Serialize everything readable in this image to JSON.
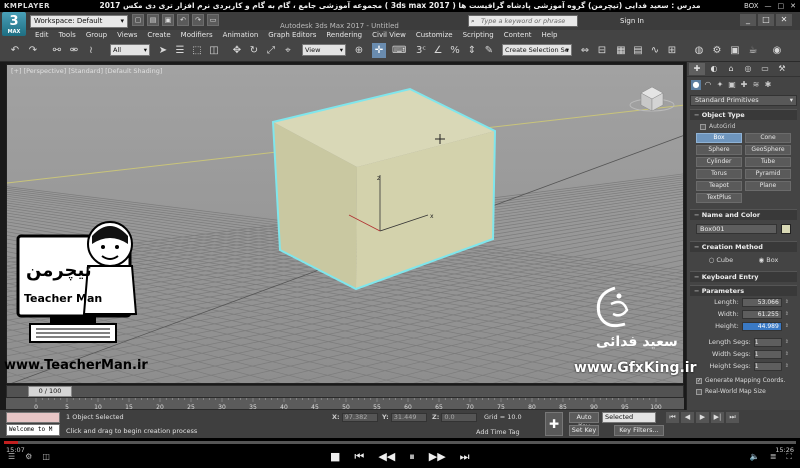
{
  "player": {
    "brand": "KMPLAYER",
    "top_right": "BOX",
    "course_title": "مجموعه آموزشی جامع ، گام به گام و کاربردی نرم افزار تری دی مکس 2017 ( 3ds max 2017 ) مدرس : سعید فدایی (تیچرمن) گروه آموزشی پادشاه گرافیست ها",
    "time_current": "15:07",
    "time_total": "15:26"
  },
  "app": {
    "logo_text": "3",
    "logo_sub": "MAX",
    "workspace": "Workspace: Default",
    "title": "Autodesk 3ds Max 2017 - Untitled",
    "search_placeholder": "Type a keyword or phrase",
    "sign_in": "Sign In"
  },
  "menu": [
    "Edit",
    "Tools",
    "Group",
    "Views",
    "Create",
    "Modifiers",
    "Animation",
    "Graph Editors",
    "Rendering",
    "Civil View",
    "Customize",
    "Scripting",
    "Content",
    "Help"
  ],
  "toolbar": {
    "filter": "All",
    "ref_coord": "View",
    "selection_set": "Create Selection Se"
  },
  "viewport": {
    "label": "[+] [Perspective] [Standard] [Default Shading]",
    "axis_z": "z",
    "axis_x": "x"
  },
  "panel": {
    "category": "Standard Primitives",
    "object_type": {
      "title": "Object Type",
      "autogrid": "AutoGrid",
      "buttons": [
        "Box",
        "Cone",
        "Sphere",
        "GeoSphere",
        "Cylinder",
        "Tube",
        "Torus",
        "Pyramid",
        "Teapot",
        "Plane",
        "TextPlus"
      ]
    },
    "name_color": {
      "title": "Name and Color",
      "name": "Box001",
      "color": "#d8d8b4"
    },
    "creation": {
      "title": "Creation Method",
      "opt1": "Cube",
      "opt2": "Box"
    },
    "keyboard": {
      "title": "Keyboard Entry"
    },
    "params": {
      "title": "Parameters",
      "length_label": "Length:",
      "length": "53.066",
      "width_label": "Width:",
      "width": "61.255",
      "height_label": "Height:",
      "height": "44.989",
      "lsegs_label": "Length Segs:",
      "lsegs": "1",
      "wsegs_label": "Width Segs:",
      "wsegs": "1",
      "hsegs_label": "Height Segs:",
      "hsegs": "1",
      "gen_map": "Generate Mapping Coords.",
      "real_world": "Real-World Map Size"
    }
  },
  "timeline": {
    "frame": "0 / 100",
    "ticks": [
      "0",
      "5",
      "10",
      "15",
      "20",
      "25",
      "30",
      "35",
      "40",
      "45",
      "50",
      "55",
      "60",
      "65",
      "70",
      "75",
      "80",
      "85",
      "90",
      "95",
      "100"
    ]
  },
  "status": {
    "listener": "Welcome to M",
    "selection": "1 Object Selected",
    "prompt": "Click and drag to begin creation process",
    "x_label": "X:",
    "x": "97.382",
    "y_label": "Y:",
    "y": "31.449",
    "z_label": "Z:",
    "z": "0.0",
    "grid": "Grid = 10.0",
    "add_tag": "Add Time Tag",
    "auto_key": "Auto Key",
    "set_key": "Set Key",
    "selected": "Selected",
    "key_filters": "Key Filters..."
  },
  "overlay": {
    "tm_url": "www.TeacherMan.ir",
    "tm_brand": "Teacher Man",
    "tm_fa": "تیچرمن",
    "gfx_name": "سعید فدائی",
    "gfx_url": "www.GfxKing.ir"
  },
  "colors": {
    "box_face": "#d2d1ad",
    "selection": "#7fe6ec",
    "viewport_bg": "#989898"
  }
}
